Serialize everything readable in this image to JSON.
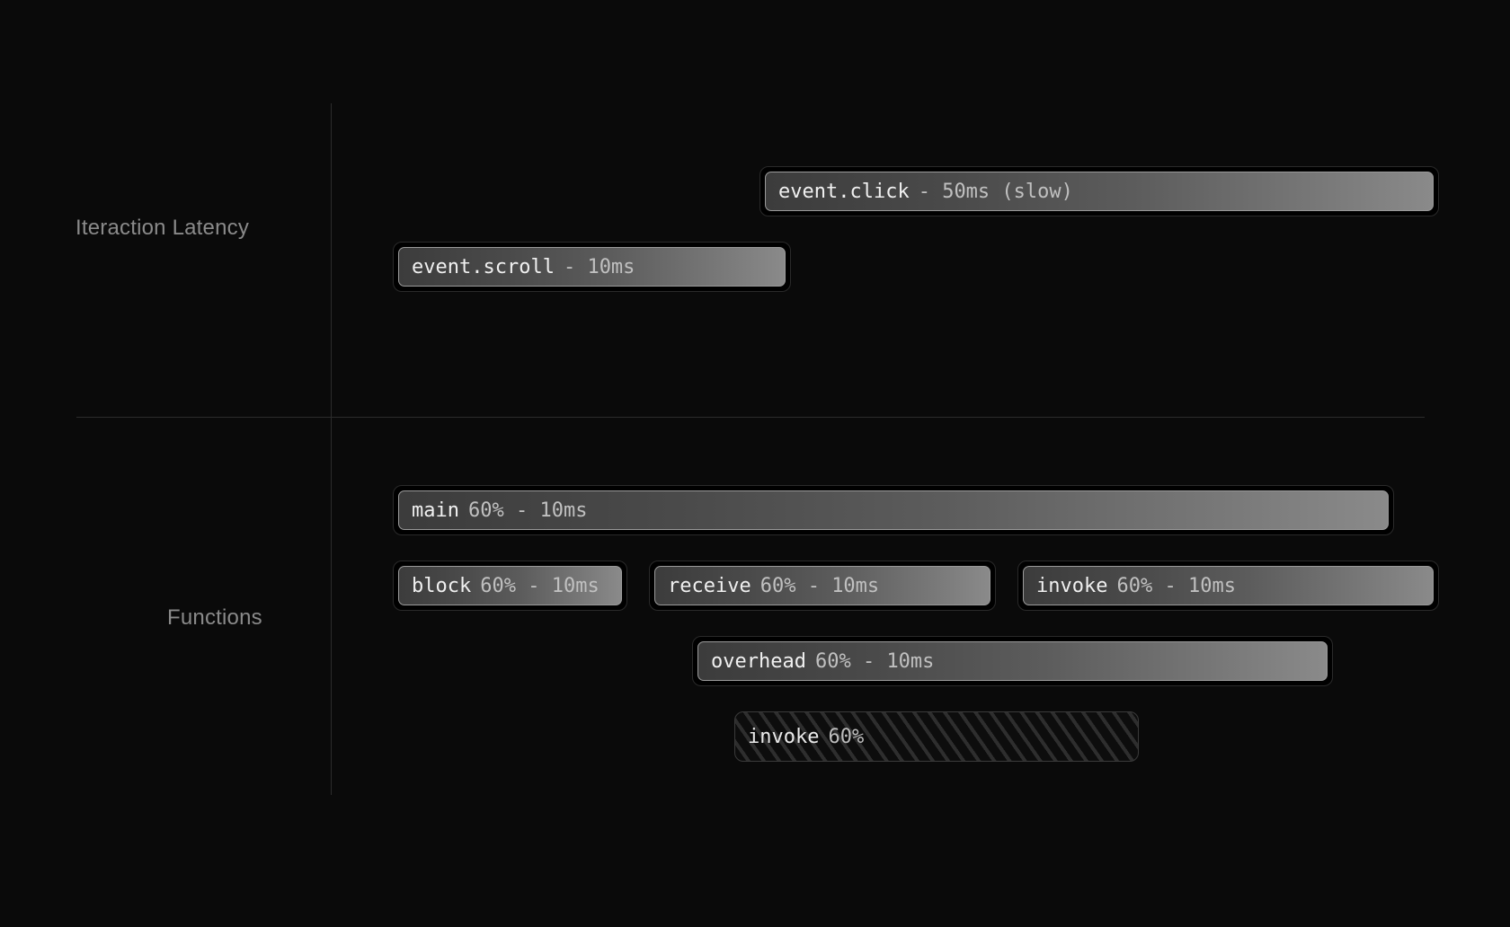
{
  "sections": {
    "latency_label": "Iteraction Latency",
    "functions_label": "Functions"
  },
  "latency": {
    "event_click": {
      "name": "event.click",
      "meta": "- 50ms (slow)"
    },
    "event_scroll": {
      "name": "event.scroll",
      "meta": "- 10ms"
    }
  },
  "functions": {
    "main": {
      "name": "main",
      "meta": "60% - 10ms"
    },
    "block": {
      "name": "block",
      "meta": "60% - 10ms"
    },
    "receive": {
      "name": "receive",
      "meta": "60% - 10ms"
    },
    "invoke": {
      "name": "invoke",
      "meta": "60% - 10ms"
    },
    "overhead": {
      "name": "overhead",
      "meta": "60% - 10ms"
    },
    "invoke2": {
      "name": "invoke",
      "meta": "60%"
    }
  }
}
